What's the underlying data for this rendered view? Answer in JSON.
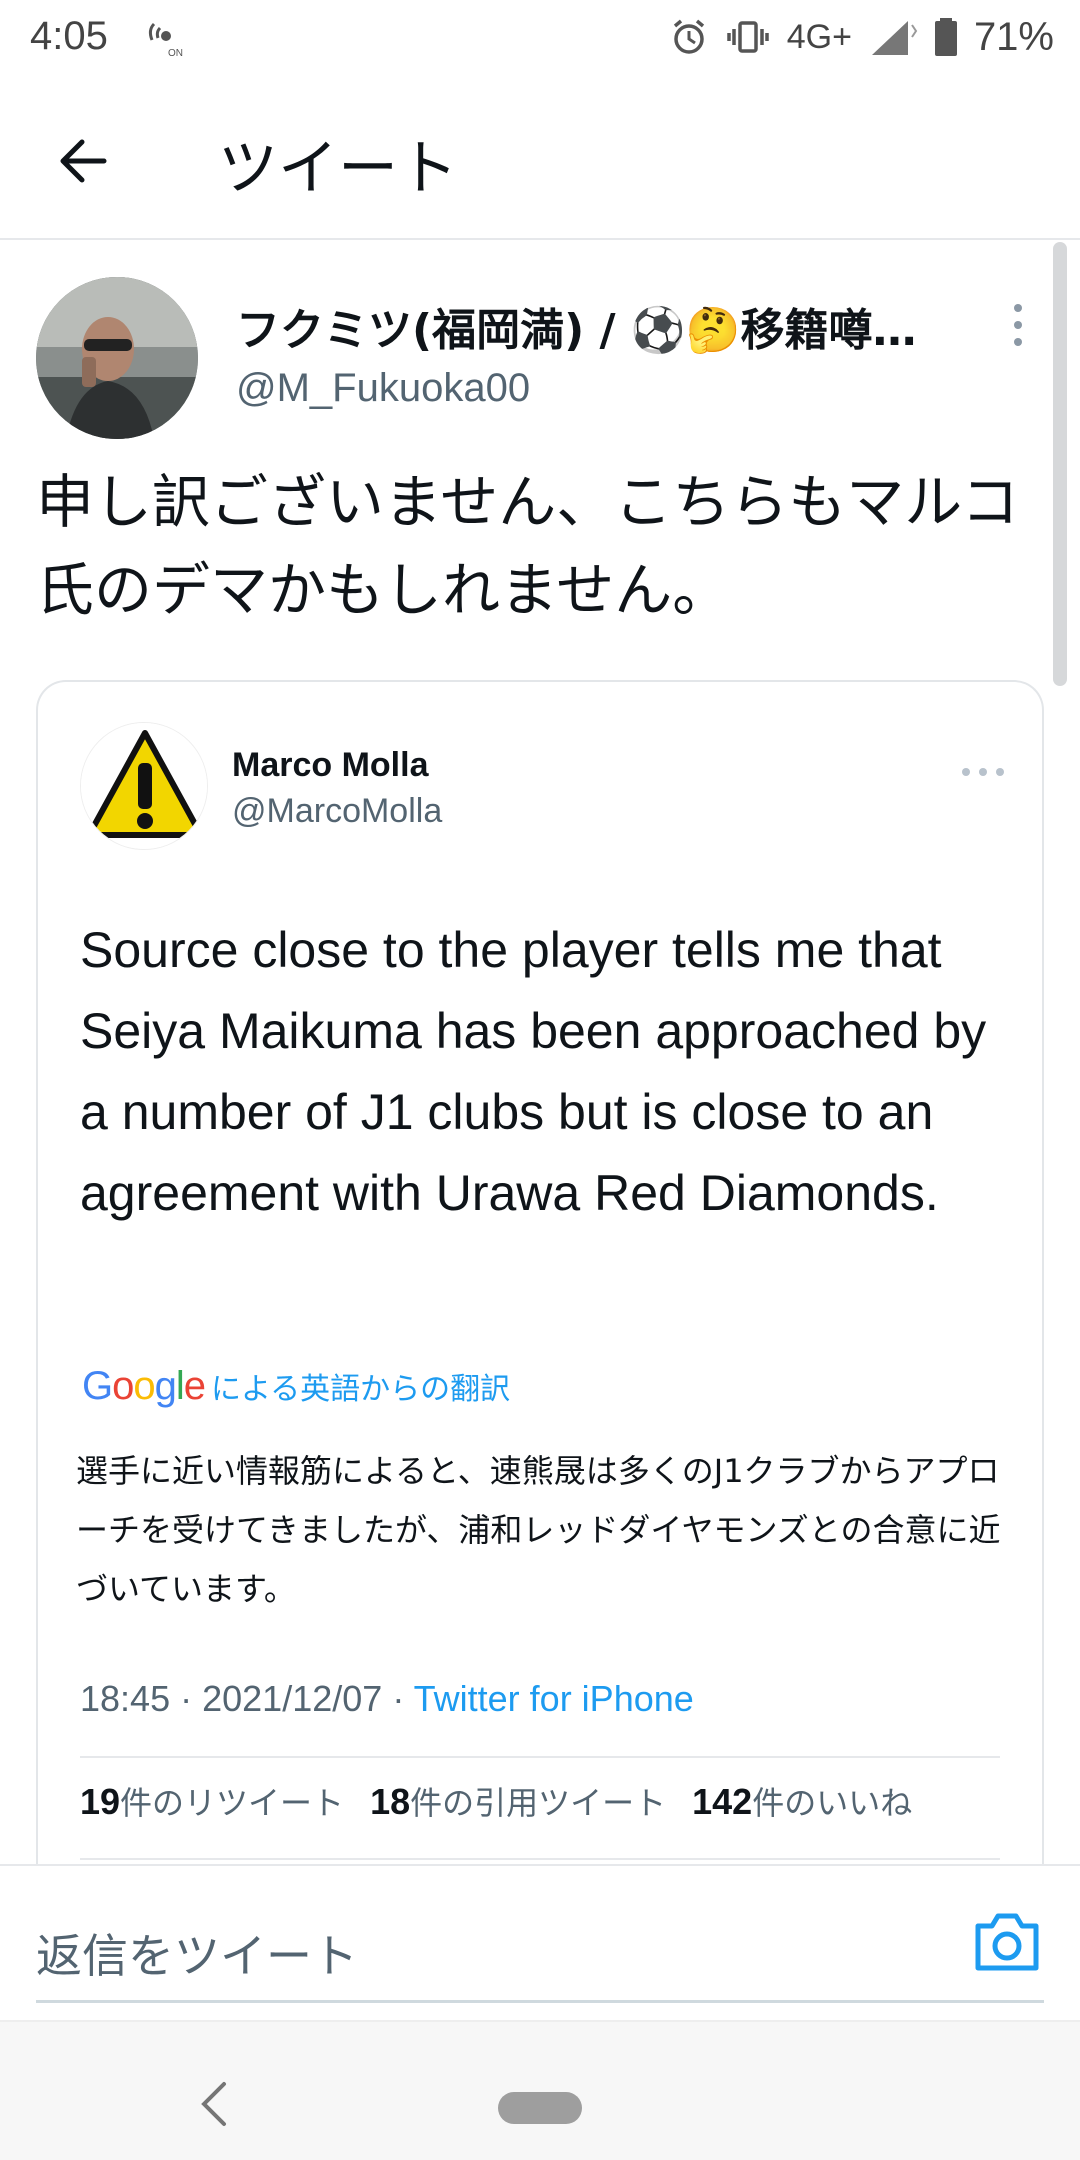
{
  "status_bar": {
    "time": "4:05",
    "network": "4G+",
    "battery": "71%"
  },
  "header": {
    "title": "ツイート"
  },
  "tweet": {
    "author_name": "フクミツ(福岡満) / ⚽🤔移籍噂…",
    "author_handle": "@M_Fukuoka00",
    "text": "申し訳ございません、こちらもマルコ氏のデマかもしれません。"
  },
  "quoted_tweet": {
    "author_name": "Marco Molla",
    "author_handle": "@MarcoMolla",
    "text": "Source close to the player tells me that Seiya Maikuma has been approached by a number of J1 clubs but is close to an agreement with Urawa Red Diamonds.",
    "translation_label": "による英語からの翻訳",
    "translation": "選手に近い情報筋によると、速熊晟は多くのJ1クラブからアプローチを受けてきましたが、浦和レッドダイヤモンズとの合意に近づいています。",
    "time": "18:45",
    "date": "2021/12/07",
    "source": "Twitter for iPhone",
    "retweets": "19",
    "retweets_label": "件のリツイート",
    "quotes": "18",
    "quotes_label": "件の引用ツイート",
    "likes": "142",
    "likes_label": "件のいいね"
  },
  "reply": {
    "placeholder": "返信をツイート"
  }
}
